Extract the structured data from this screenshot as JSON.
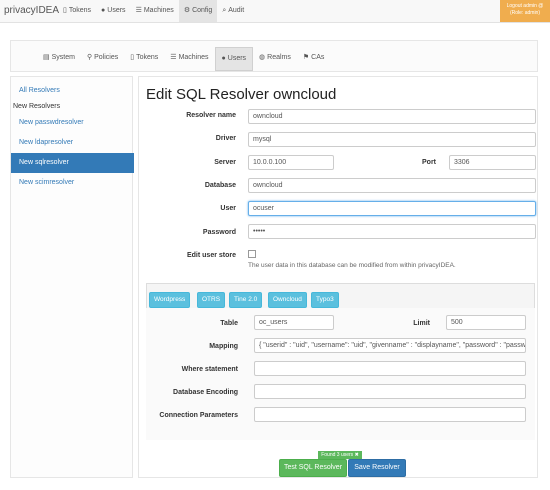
{
  "header": {
    "brand": "privacyIDEA",
    "nav": [
      {
        "label": "Tokens",
        "icon": "mobile-icon"
      },
      {
        "label": "Users",
        "icon": "user-icon"
      },
      {
        "label": "Machines",
        "icon": "list-icon"
      },
      {
        "label": "Config",
        "icon": "gear-icon",
        "active": true
      },
      {
        "label": "Audit",
        "icon": "search-icon"
      }
    ],
    "logout_line1": "Logout admin @",
    "logout_line2": "(Role: admin)"
  },
  "subnav": [
    {
      "label": "System",
      "icon": "system-icon"
    },
    {
      "label": "Policies",
      "icon": "policy-icon"
    },
    {
      "label": "Tokens",
      "icon": "mobile-icon"
    },
    {
      "label": "Machines",
      "icon": "list-icon"
    },
    {
      "label": "Users",
      "icon": "user-icon",
      "active": true
    },
    {
      "label": "Realms",
      "icon": "globe-icon"
    },
    {
      "label": "CAs",
      "icon": "flag-icon"
    }
  ],
  "sidebar": {
    "all_resolvers": "All Resolvers",
    "new_resolvers_header": "New Resolvers",
    "items": [
      "New passwdresolver",
      "New ldapresolver",
      "New sqlresolver",
      "New scimresolver"
    ]
  },
  "form": {
    "title": "Edit SQL Resolver owncloud",
    "labels": {
      "resolver_name": "Resolver name",
      "driver": "Driver",
      "server": "Server",
      "port": "Port",
      "database": "Database",
      "user": "User",
      "password": "Password",
      "edit_user_store": "Edit user store"
    },
    "values": {
      "resolver_name": "owncloud",
      "driver": "mysql",
      "server": "10.0.0.100",
      "port": "3306",
      "database": "owncloud",
      "user": "ocuser",
      "password": "•••••"
    },
    "edit_user_store_help": "The user data in this database can be modified from within privacyIDEA."
  },
  "panel": {
    "quick_buttons": [
      "Wordpress",
      "OTRS",
      "Tine 2.0",
      "Owncloud",
      "Typo3"
    ],
    "labels": {
      "table": "Table",
      "limit": "Limit",
      "mapping": "Mapping",
      "where": "Where statement",
      "encoding": "Database Encoding",
      "conn_params": "Connection Parameters"
    },
    "values": {
      "table": "oc_users",
      "limit": "500",
      "mapping": "{ \"userid\" : \"uid\", \"username\": \"uid\", \"givenname\" : \"displayname\", \"password\" : \"passwon"
    }
  },
  "footer": {
    "found_badge": "Found 3 users ✖",
    "test_button": "Test SQL Resolver",
    "save_button": "Save Resolver"
  },
  "colors": {
    "primary": "#337ab7",
    "info": "#5bc0de",
    "success": "#5cb85c",
    "warning": "#f0ad4e"
  }
}
